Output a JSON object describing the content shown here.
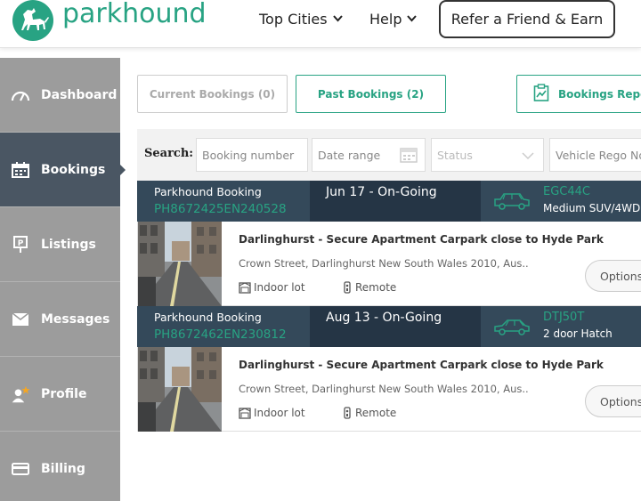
{
  "brand": {
    "name": "parkhound",
    "color": "#28a383"
  },
  "header": {
    "nav": [
      {
        "label": "Top Cities"
      },
      {
        "label": "Help"
      }
    ],
    "refer_label": "Refer a Friend & Earn"
  },
  "sidebar": {
    "items": [
      {
        "label": "Dashboard",
        "icon": "gauge-icon"
      },
      {
        "label": "Bookings",
        "icon": "calendar-icon",
        "active": true
      },
      {
        "label": "Listings",
        "icon": "parking-sign-icon"
      },
      {
        "label": "Messages",
        "icon": "envelope-icon"
      },
      {
        "label": "Profile",
        "icon": "user-icon"
      },
      {
        "label": "Billing",
        "icon": "credit-card-icon"
      }
    ]
  },
  "tabs": {
    "current": "Current Bookings (0)",
    "past": "Past Bookings (2)",
    "report": "Bookings Repor"
  },
  "search": {
    "label": "Search:",
    "booking_placeholder": "Booking number",
    "date_placeholder": "Date range",
    "status_placeholder": "Status",
    "rego_placeholder": "Vehicle Rego No."
  },
  "bookings": [
    {
      "title": "Parkhound Booking",
      "code": "PH8672425EN240528",
      "date": "Jun 17 - On-Going",
      "plate": "EGC44C",
      "vehicle_type": "Medium SUV/4WD",
      "name": "Darlinghurst - Secure Apartment Carpark close to Hyde Park",
      "address": "Crown Street, Darlinghurst New South Wales 2010, Aus..",
      "feature1": "Indoor lot",
      "feature2": "Remote",
      "options": "Options"
    },
    {
      "title": "Parkhound Booking",
      "code": "PH8672462EN230812",
      "date": "Aug 13 - On-Going",
      "plate": "DTJ50T",
      "vehicle_type": "2 door Hatch",
      "name": "Darlinghurst - Secure Apartment Carpark close to Hyde Park",
      "address": "Crown Street, Darlinghurst New South Wales 2010, Aus..",
      "feature1": "Indoor lot",
      "feature2": "Remote",
      "options": "Options"
    }
  ]
}
